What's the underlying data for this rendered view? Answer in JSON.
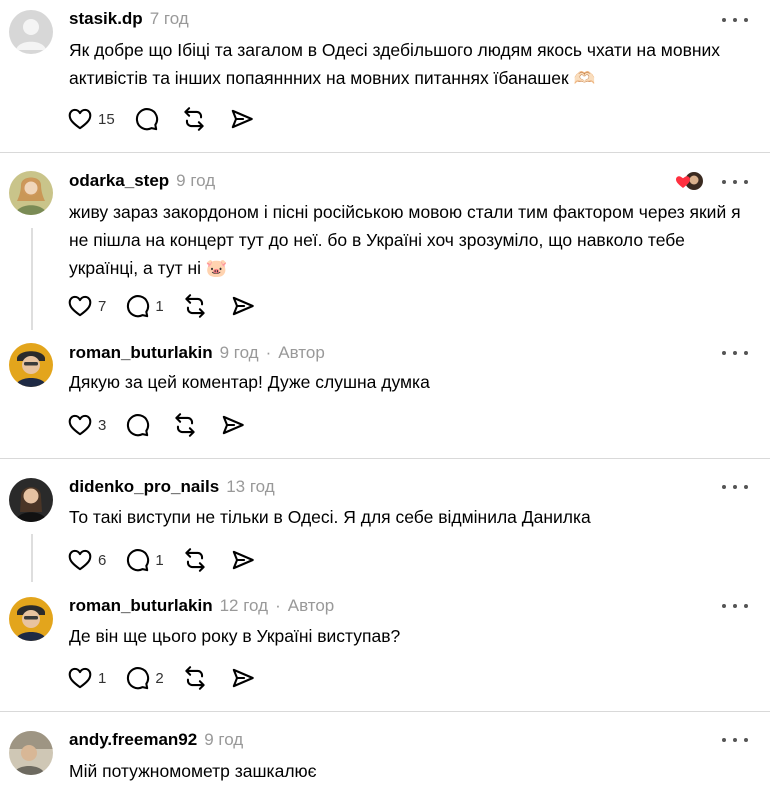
{
  "comments": [
    {
      "username": "stasik.dp",
      "time": "7 год",
      "text": "Як добре що Ібіці та загалом в Одесі здебільшого людям якось чхати на мовних активістів та інших попаяннних на мовних питаннях їбанашек 🫶🏻",
      "likes": "15",
      "replies": ""
    },
    {
      "username": "odarka_step",
      "time": "9 год",
      "text": "живу зараз закордоном і пісні російською мовою стали тим фактором через який я не пішла на концерт тут до неї. бо в Україні хоч зрозуміло, що навколо тебе українці, а тут ні 🐷",
      "likes": "7",
      "replies": "1"
    },
    {
      "username": "roman_buturlakin",
      "time": "9 год",
      "author_label": "Автор",
      "text": "Дякую за цей коментар! Дуже слушна думка",
      "likes": "3",
      "replies": ""
    },
    {
      "username": "didenko_pro_nails",
      "time": "13 год",
      "text": "То такі виступи не тільки в Одесі. Я для себе відмінила Данилка",
      "likes": "6",
      "replies": "1"
    },
    {
      "username": "roman_buturlakin",
      "time": "12 год",
      "author_label": "Автор",
      "text": "Де він ще цього року в Україні виступав?",
      "likes": "1",
      "replies": "2"
    },
    {
      "username": "andy.freeman92",
      "time": "9 год",
      "text": "Мій потужномометр зашкалює",
      "likes": "",
      "replies": ""
    }
  ],
  "icons": {
    "like": "heart-icon",
    "reply": "comment-bubble-icon",
    "repost": "repost-icon",
    "share": "send-icon",
    "more": "more-dots-icon"
  },
  "colors": {
    "text": "#000000",
    "muted": "#999999",
    "divider": "#d9d9d9",
    "icon": "#000000",
    "reaction_heart": "#ff3040"
  }
}
